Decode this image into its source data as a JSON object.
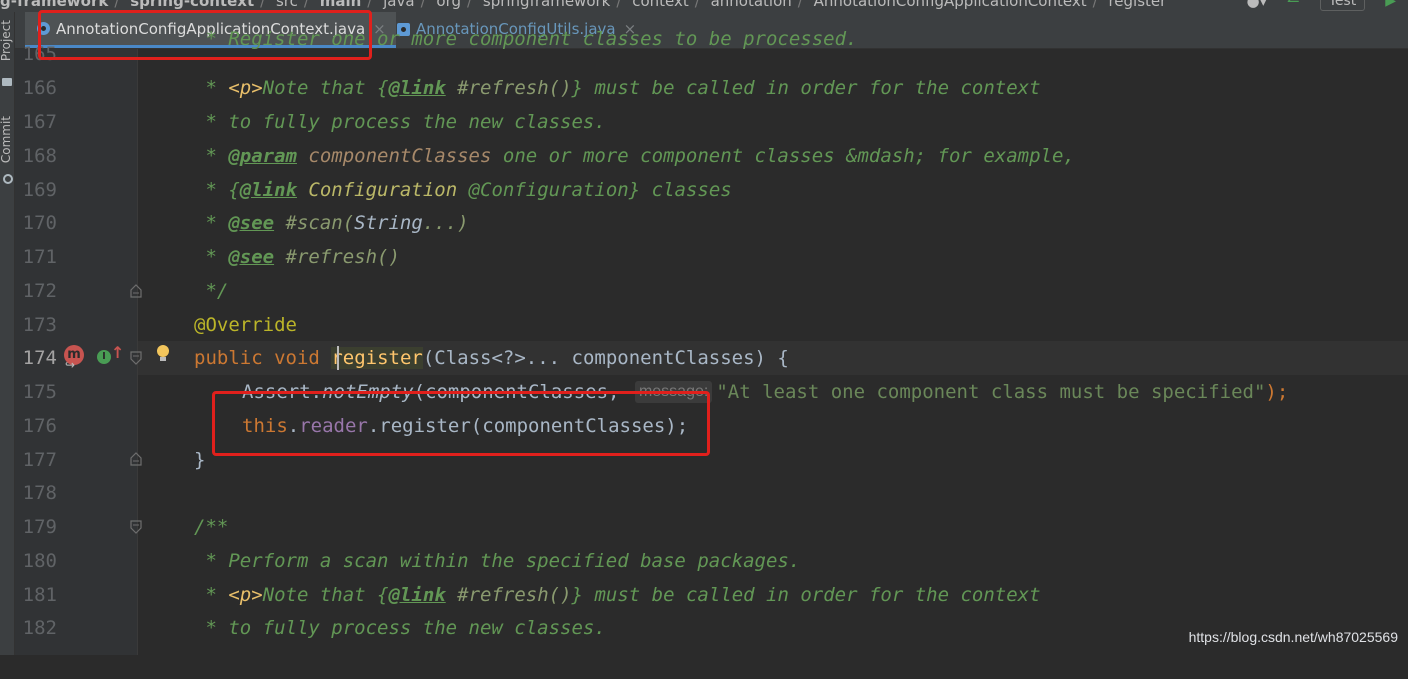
{
  "breadcrumb": {
    "items": [
      "g-framework",
      "spring-context",
      "src",
      "main",
      "java",
      "org",
      "springframework",
      "context",
      "annotation",
      "AnnotationConfigApplicationContext",
      "register"
    ],
    "run_config": "Test"
  },
  "toolstrip": {
    "project_label": "Project",
    "commit_label": "Commit"
  },
  "tabs": [
    {
      "label": "AnnotationConfigApplicationContext.java",
      "active": true
    },
    {
      "label": "AnnotationConfigUtils.java",
      "active": false
    }
  ],
  "editor": {
    "lines": [
      {
        "num": "165",
        "doc1": " * Register one or more component classes to be processed."
      },
      {
        "num": "166"
      },
      {
        "num": "167",
        "doc": " * to fully process the new classes."
      },
      {
        "num": "168"
      },
      {
        "num": "169"
      },
      {
        "num": "170"
      },
      {
        "num": "171"
      },
      {
        "num": "172",
        "doc": " */"
      },
      {
        "num": "173",
        "annotation": "@Override"
      },
      {
        "num": "174"
      },
      {
        "num": "175"
      },
      {
        "num": "176"
      },
      {
        "num": "177",
        "text": "}"
      },
      {
        "num": "178"
      },
      {
        "num": "179",
        "doc": "/**"
      },
      {
        "num": "180",
        "doc": " * Perform a scan within the specified base packages."
      },
      {
        "num": "181"
      },
      {
        "num": "182",
        "doc": " * to fully process the new classes."
      }
    ],
    "tokens": {
      "star": " * ",
      "p_tag": "<p>",
      "note_that": "Note that ",
      "brace_open": "{",
      "link_tag": "@link",
      "refresh_ref": " #refresh()",
      "brace_close": "}",
      "must_be_called": " must be called in order for the context",
      "param_tag": "@param",
      "param_name": " componentClasses",
      "param_desc": " one or more component classes &mdash; for example,",
      "config_ref": " Configuration",
      "config_text": " @Configuration",
      "classes_word": " classes",
      "see_tag": "@see",
      "scan_ref_a": " #scan(",
      "scan_ref_b": "String",
      "scan_ref_c": "...)",
      "refresh_see": " #refresh()",
      "kw_public": "public",
      "kw_void": "void",
      "method_name": "register",
      "params": "(Class<?>... componentClasses) {",
      "assert_cls": "Assert.",
      "assert_m": "notEmpty",
      "assert_arg": "(componentClasses, ",
      "hint_label": "message:",
      "assert_msg": "\"At least one component class must be specified\"",
      "assert_end": ");",
      "kw_this": "this",
      "dot": ".",
      "reader_field": "reader",
      "reader_call": ".register(componentClasses);"
    }
  },
  "watermark": "https://blog.csdn.net/wh87025569"
}
